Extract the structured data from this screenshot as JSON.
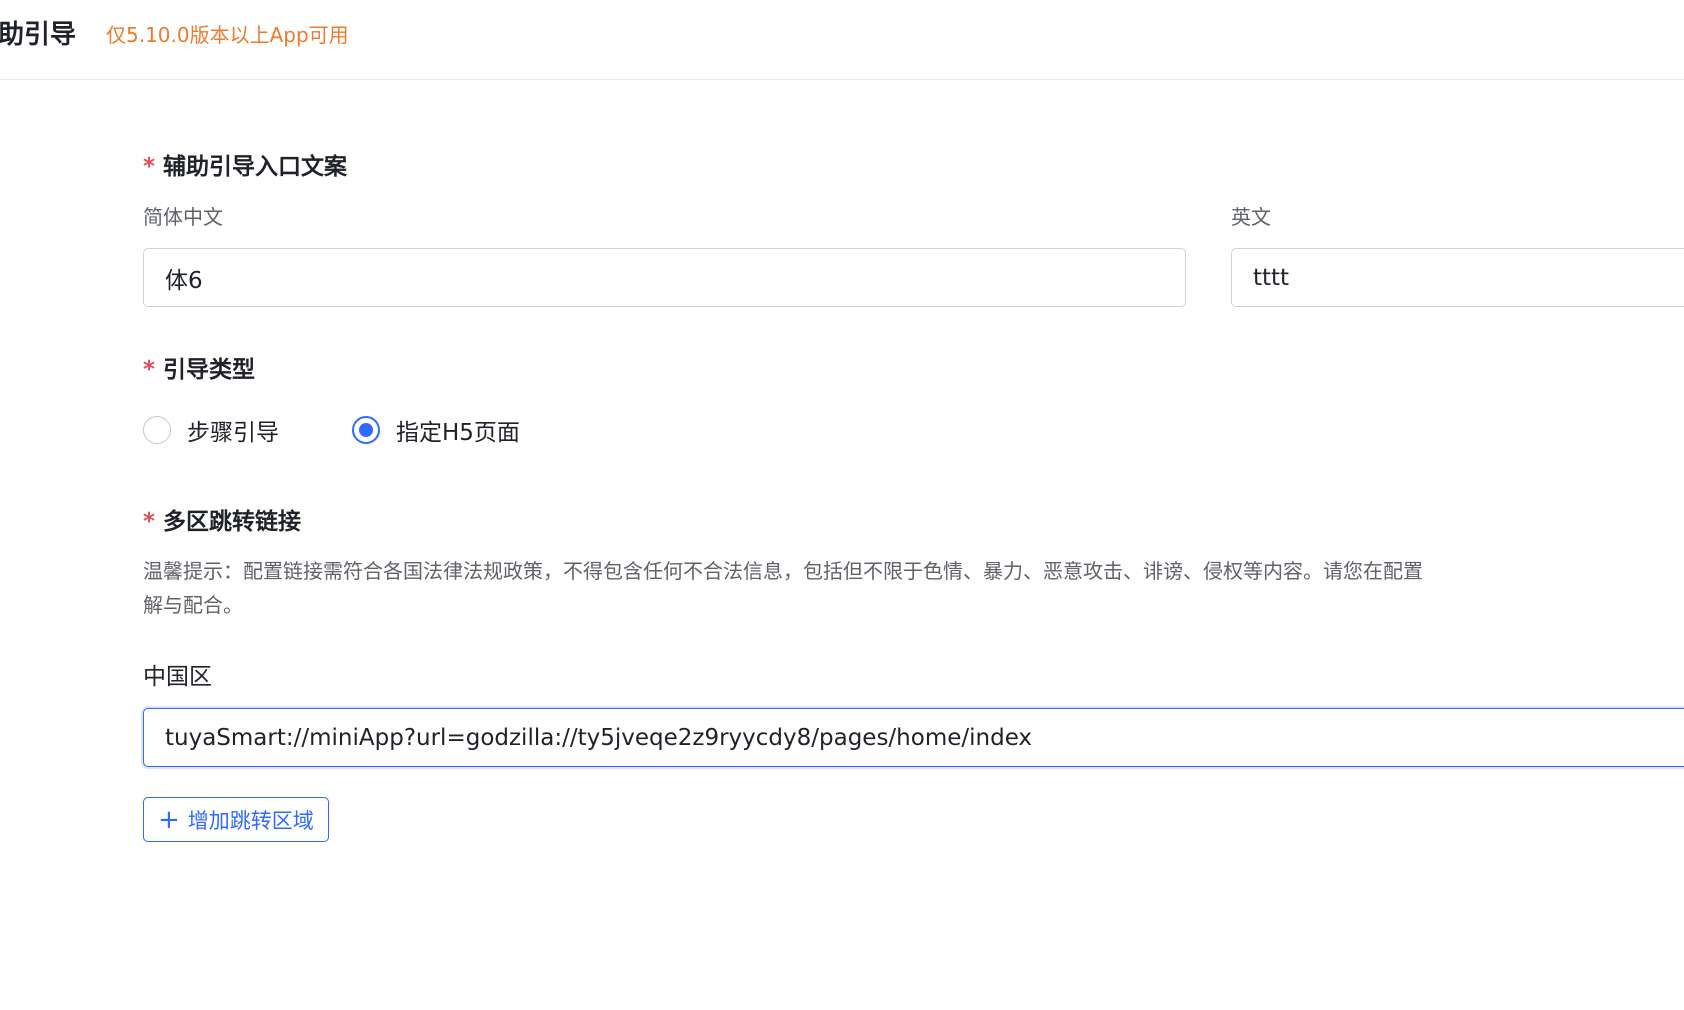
{
  "header": {
    "title": "助引导",
    "note": "仅5.10.0版本以上App可用"
  },
  "entry_text": {
    "label": "辅助引导入口文案",
    "required_mark": "*",
    "zh_label": "简体中文",
    "zh_value": "体6",
    "en_label": "英文",
    "en_value": "tttt"
  },
  "guide_type": {
    "label": "引导类型",
    "required_mark": "*",
    "options": [
      {
        "label": "步骤引导",
        "checked": false
      },
      {
        "label": "指定H5页面",
        "checked": true
      }
    ]
  },
  "multi_region": {
    "label": "多区跳转链接",
    "required_mark": "*",
    "tip": "温馨提示：配置链接需符合各国法律法规政策，不得包含任何不合法信息，包括但不限于色情、暴力、恶意攻击、诽谤、侵权等内容。请您在配置\n解与配合。",
    "region_label": "中国区",
    "region_value": "tuyaSmart://miniApp?url=godzilla://ty5jveqe2z9ryycdy8/pages/home/index",
    "add_button_label": "增加跳转区域",
    "add_button_icon": "plus-icon"
  },
  "colors": {
    "accent": "#2f6bff",
    "warning": "#ed7b2f",
    "required": "#e34d59"
  }
}
